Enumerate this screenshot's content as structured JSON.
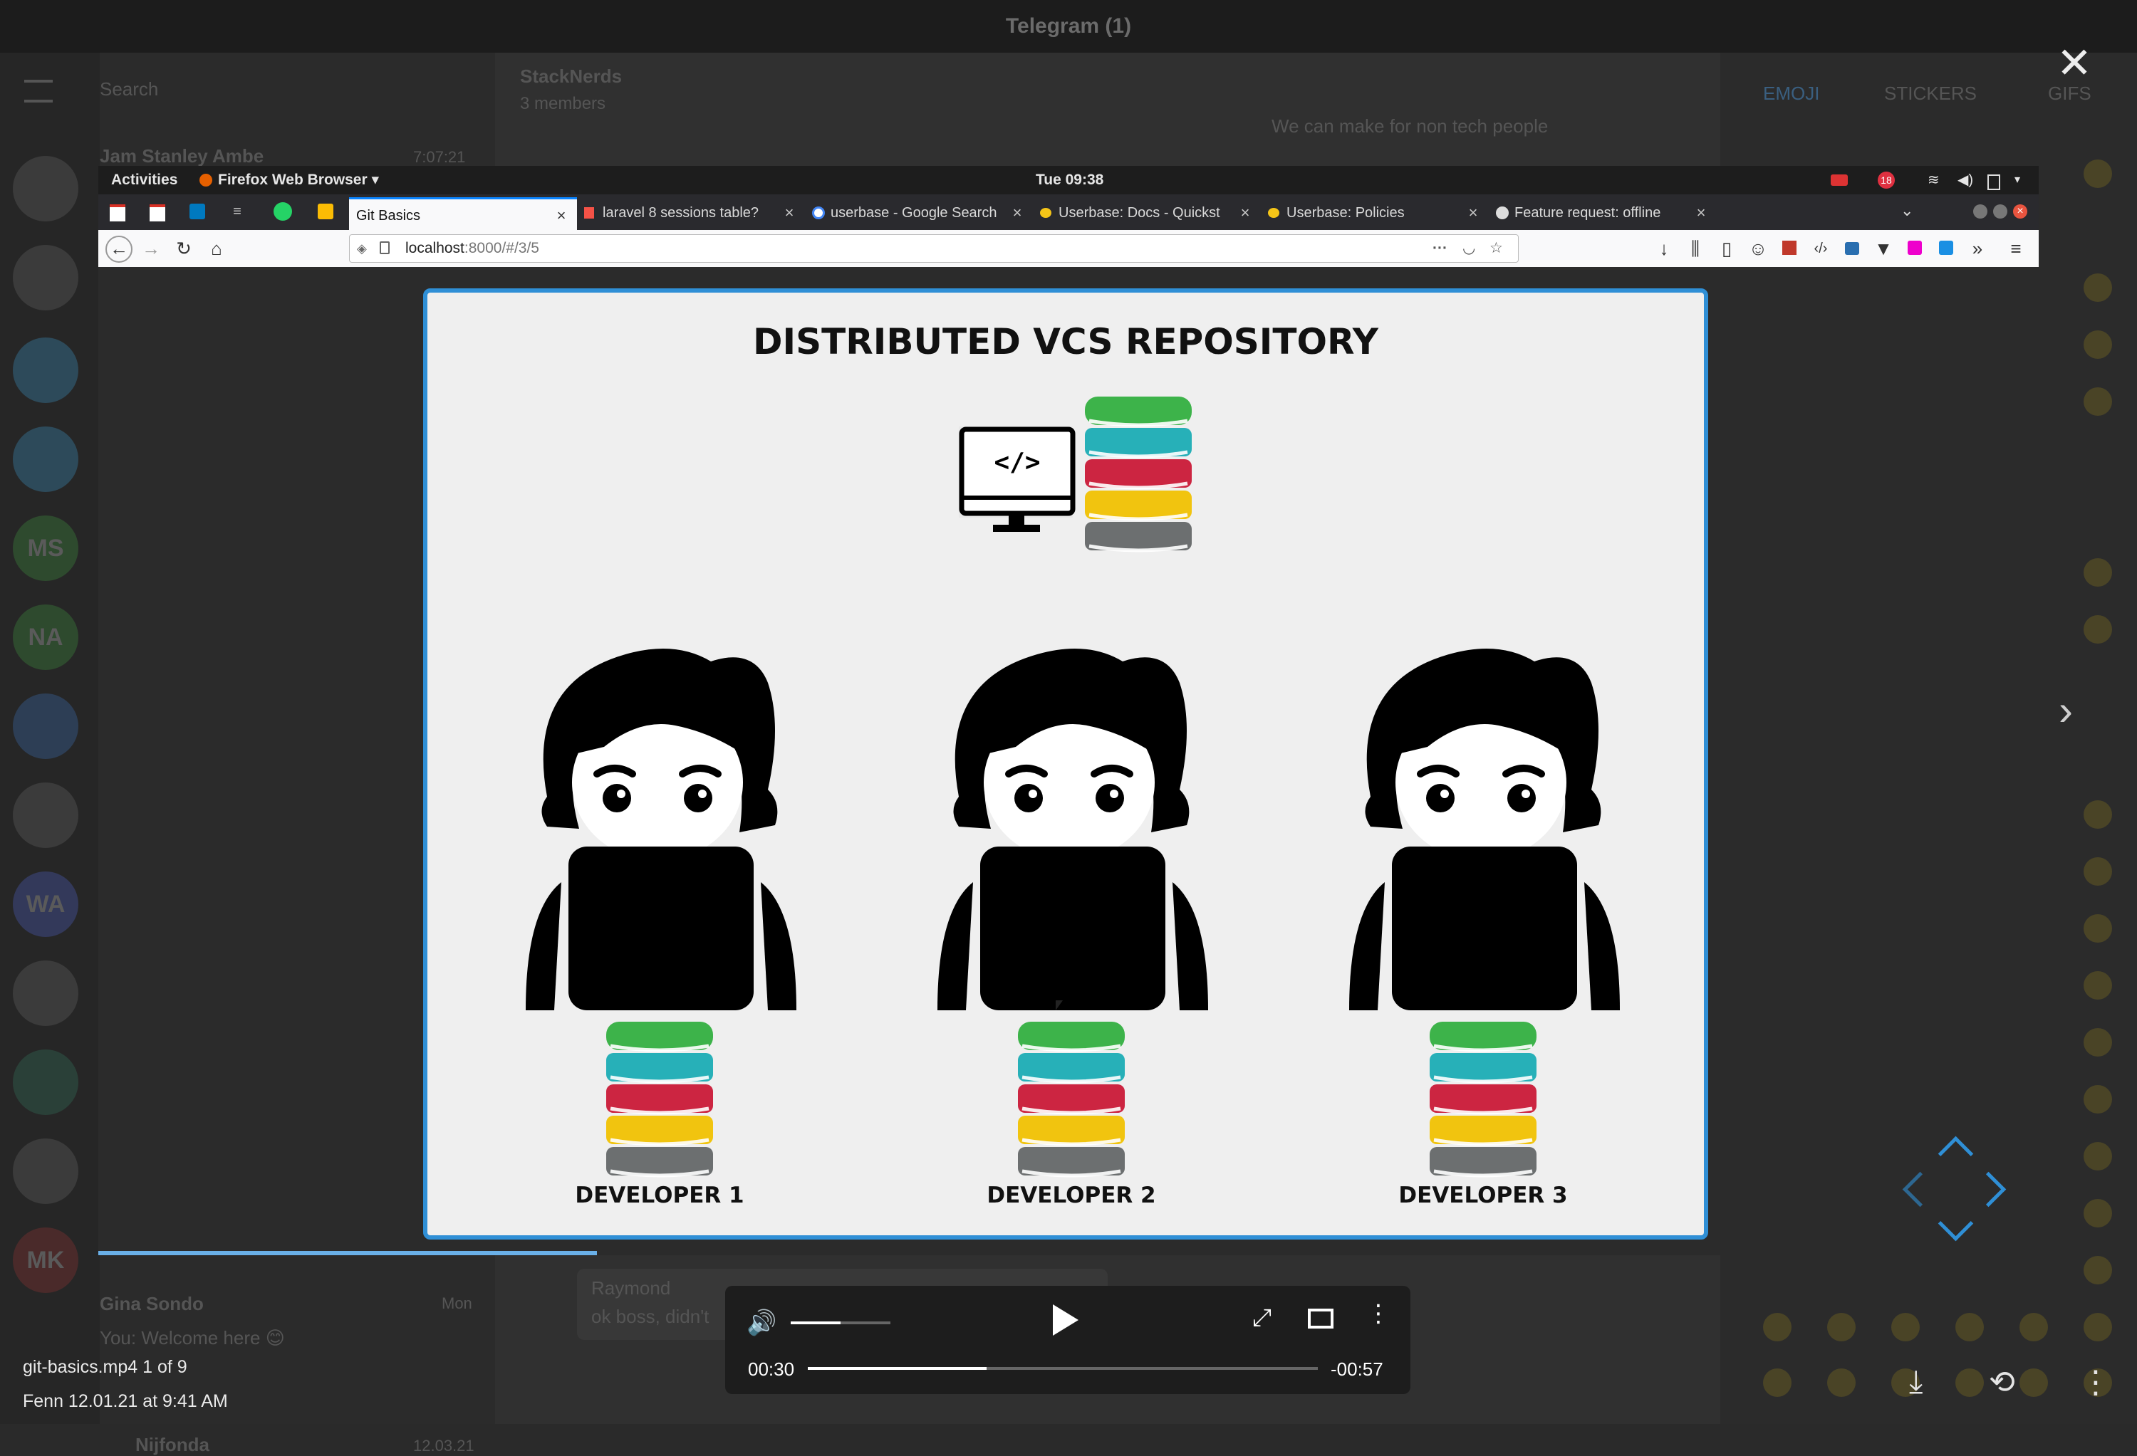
{
  "telegram": {
    "window_title": "Telegram (1)",
    "search_placeholder": "Search",
    "chat_header": {
      "title": "StackNerds",
      "subtitle": "3 members"
    },
    "chats": [
      {
        "name": "Jam Stanley Ambe",
        "time": "7:07:21"
      },
      {
        "name": "Gina Sondo",
        "time": "Mon",
        "preview": "You: Welcome here 😊"
      },
      {
        "name": "Nijfonda",
        "time": "12.03.21"
      }
    ],
    "sidebar_avatars": [
      "MS",
      "NA",
      "WA",
      "MK"
    ],
    "message_snippet": "We can make for non tech people",
    "reply": {
      "author": "Raymond",
      "text": "ok boss, didn't"
    },
    "emoji_tabs": [
      "EMOJI",
      "STICKERS",
      "GIFS"
    ]
  },
  "viewer": {
    "file_name": "git-basics.mp4 1 of 9",
    "meta": "Fenn  12.01.21 at 9:41 AM",
    "controls": {
      "elapsed": "00:30",
      "remaining": "-00:57",
      "progress_fraction": 0.35,
      "volume_fraction": 0.5
    }
  },
  "desktop": {
    "activities": "Activities",
    "app_menu": "Firefox Web Browser",
    "clock": "Tue 09:38",
    "notif_count": "18"
  },
  "browser": {
    "tabs": [
      {
        "label": "Git Basics",
        "active": true
      },
      {
        "label": "laravel 8 sessions table?"
      },
      {
        "label": "userbase - Google Search"
      },
      {
        "label": "Userbase: Docs - Quickst"
      },
      {
        "label": "Userbase: Policies"
      },
      {
        "label": "Feature request: offline"
      }
    ],
    "url_host": "localhost",
    "url_rest": ":8000/#/3/5"
  },
  "slide": {
    "title": "DISTRIBUTED VCS REPOSITORY",
    "developers": [
      "DEVELOPER 1",
      "DEVELOPER 2",
      "DEVELOPER 3"
    ],
    "db_colors": [
      "#3db34a",
      "#27b0b8",
      "#cc2541",
      "#f1c40f",
      "#6c6f70"
    ]
  }
}
